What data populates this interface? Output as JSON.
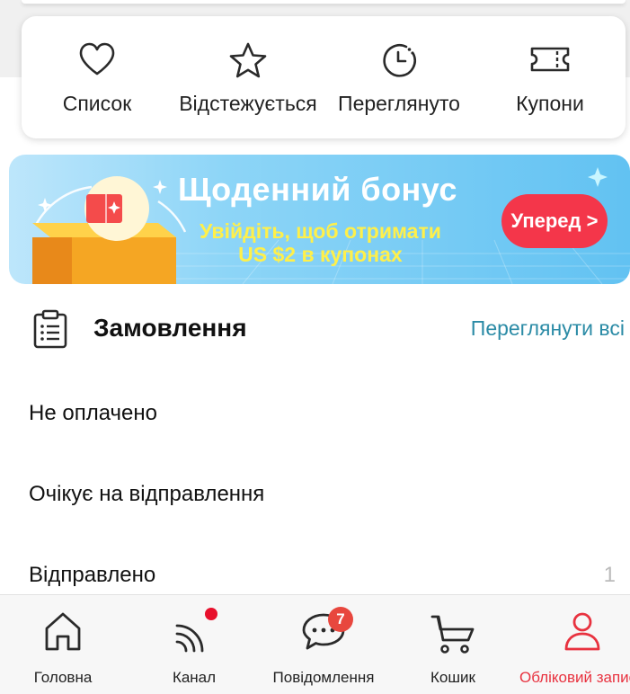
{
  "quick_links": [
    {
      "label": "Список",
      "icon": "heart-icon"
    },
    {
      "label": "Відстежується",
      "icon": "star-icon"
    },
    {
      "label": "Переглянуто",
      "icon": "history-clock-icon"
    },
    {
      "label": "Купони",
      "icon": "coupon-ticket-icon"
    }
  ],
  "banner": {
    "title": "Щоденний бонус",
    "subtitle_line1": "Увійдіть, щоб отримати",
    "subtitle_line2": "US $2 в купонах",
    "cta": "Уперед >"
  },
  "orders": {
    "title": "Замовлення",
    "view_all": "Переглянути всі",
    "statuses": [
      {
        "label": "Не оплачено",
        "count": ""
      },
      {
        "label": "Очікує на відправлення",
        "count": ""
      },
      {
        "label": "Відправлено",
        "count": "1"
      }
    ]
  },
  "bottom_nav": {
    "items": [
      {
        "label": "Головна",
        "icon": "home-icon"
      },
      {
        "label": "Канал",
        "icon": "feed-icon"
      },
      {
        "label": "Повідомлення",
        "icon": "message-icon",
        "badge": "7"
      },
      {
        "label": "Кошик",
        "icon": "cart-icon"
      },
      {
        "label": "Обліковий запис",
        "icon": "account-icon"
      }
    ]
  },
  "colors": {
    "accent": "#e8323f",
    "link": "#2b8ba6",
    "banner_cta": "#f4364a",
    "banner_subtitle": "#fff04a"
  }
}
